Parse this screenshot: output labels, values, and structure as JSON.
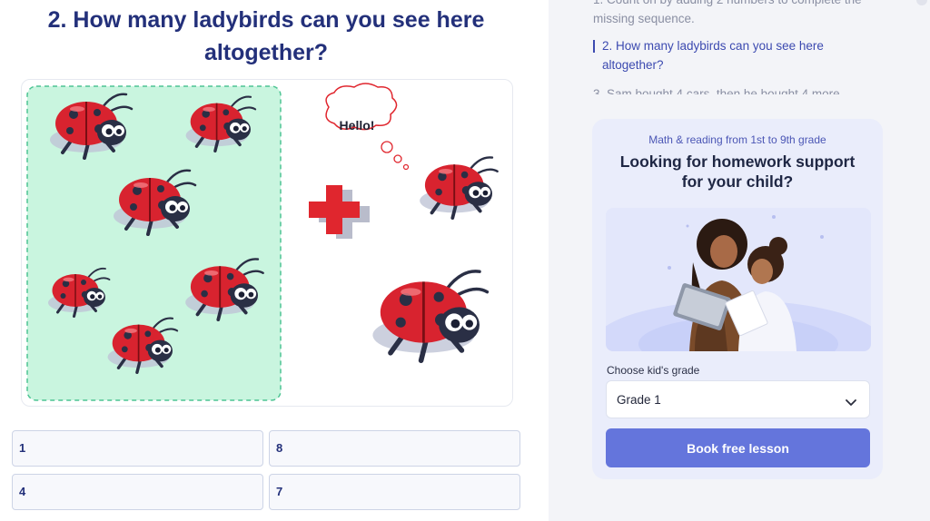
{
  "question": {
    "title_line1": "2. How many ladybirds can you see here",
    "title_line2": "altogether?",
    "bubble_text": "Hello!"
  },
  "answers": [
    "1",
    "8",
    "4",
    "7"
  ],
  "sidebar": {
    "toc_prev": "1. Count on by adding 2 numbers to complete the missing sequence.",
    "toc_active": "2. How many ladybirds can you see here altogether?",
    "toc_next": "3. Sam bought 4 cars, then he bought 4 more"
  },
  "promo": {
    "subtitle": "Math & reading from 1st to 9th grade",
    "title": "Looking for homework support for your child?",
    "grade_label": "Choose kid's grade",
    "grade_value": "Grade 1",
    "button_label": "Book free lesson"
  },
  "colors": {
    "title": "#23307a",
    "accent": "#6475dc",
    "ladybird_red": "#d8232f",
    "plus_red": "#e0262e"
  },
  "icons": {
    "select_chevron": "chevron-down-icon",
    "plus": "plus-icon"
  }
}
